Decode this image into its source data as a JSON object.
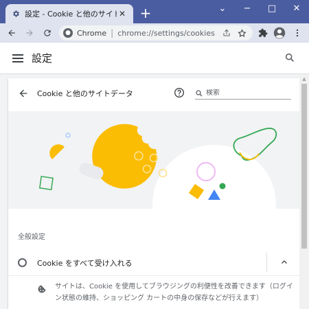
{
  "tab": {
    "title": "設定 - Cookie と他のサイトデータ",
    "close": "✕",
    "new_tab": "+"
  },
  "window": {
    "minimize": "⌄",
    "restore": "−",
    "maximize": "□",
    "close": "✕"
  },
  "omnibox": {
    "chrome_label": "Chrome",
    "separator": "|",
    "url": "chrome://settings/cookies"
  },
  "header": {
    "title": "設定"
  },
  "page": {
    "title": "Cookie と他のサイトデータ",
    "search_value": "検索"
  },
  "general": {
    "section_label": "全般設定",
    "option_label": "Cookie をすべて受け入れる",
    "description": "サイトは、Cookie を使用してブラウジングの利便性を改善できます（ログイン状態の維持、ショッピング カートの中身の保存などが行えます）"
  },
  "colors": {
    "frame": "#4b5da1",
    "cookie": "#fbbc04",
    "blue": "#4285f4",
    "green": "#34a853",
    "pink": "#f0b9f5"
  },
  "icons": {
    "settings": "gear-icon",
    "back": "arrow-left-icon",
    "forward": "arrow-right-icon",
    "reload": "reload-icon",
    "share": "share-icon",
    "star": "star-icon",
    "extensions": "puzzle-icon",
    "profile": "avatar-icon",
    "menu": "more-vert-icon",
    "help": "help-icon",
    "search": "search-icon",
    "expand": "chevron-up-icon",
    "cookie": "cookie-icon"
  }
}
